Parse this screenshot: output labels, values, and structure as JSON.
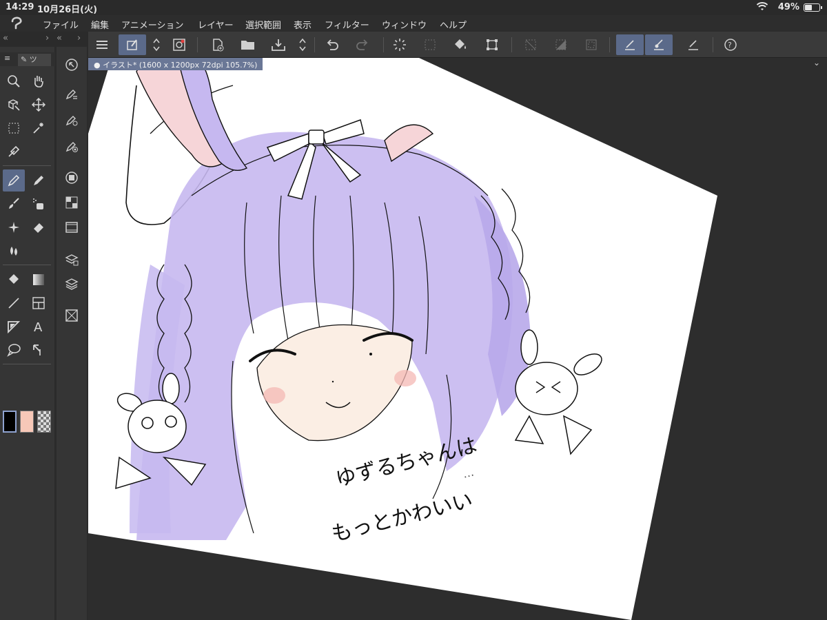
{
  "status": {
    "time": "14:29",
    "date": "10月26日(火)",
    "battery": "49%",
    "battery_level": 0.49
  },
  "menu": {
    "items": [
      "ファイル",
      "編集",
      "アニメーション",
      "レイヤー",
      "選択範囲",
      "表示",
      "フィルター",
      "ウィンドウ",
      "ヘルプ"
    ]
  },
  "panel": {
    "tab_label": "ツ"
  },
  "document": {
    "tab": "イラスト* (1600 x 1200px 72dpi 105.7%)"
  },
  "artwork": {
    "caption_line1": "ゆずるちゃんは",
    "caption_line2": "もっとかわいい",
    "caption_trail": "…"
  },
  "colors": {
    "main": "#000000",
    "sub": "#f7c8b8",
    "accent": "#5b6a8a",
    "hair": "#c6b8f0"
  },
  "icons": {
    "toolbar": [
      "menu-icon",
      "object-select-icon",
      "updown-icon",
      "quick-access-icon",
      "new-file-icon",
      "open-file-icon",
      "save-icon",
      "updown-icon",
      "undo-icon",
      "redo-icon",
      "loading-icon",
      "select-all-icon",
      "fill-icon",
      "transform-icon",
      "deselect-icon",
      "invert-selection-icon",
      "selection-border-icon",
      "pen-icon",
      "brush-icon",
      "ruler-icon",
      "help-icon"
    ],
    "tools": [
      "zoom-icon",
      "hand-icon",
      "object-icon",
      "move-icon",
      "marquee-icon",
      "auto-select-icon",
      "eyedropper-icon",
      "pen-icon",
      "pencil-icon",
      "brush-icon",
      "airbrush-icon",
      "decoration-icon",
      "eraser-icon",
      "blend-icon",
      "fill-icon",
      "gradient-icon",
      "line-icon",
      "frame-icon",
      "ruler-icon",
      "text-icon",
      "balloon-icon",
      "correct-line-icon"
    ]
  }
}
